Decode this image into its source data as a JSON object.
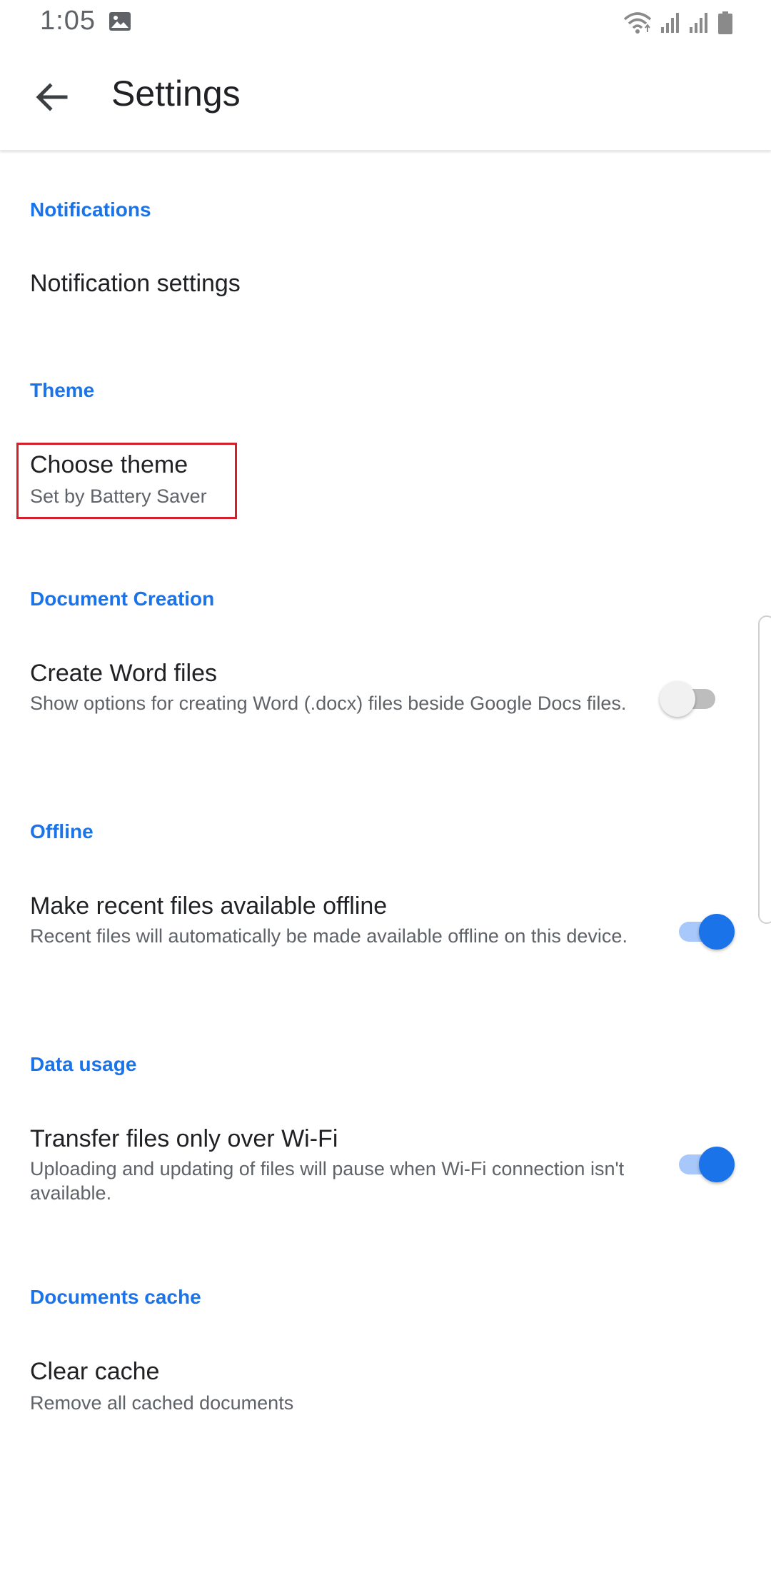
{
  "status_bar": {
    "time": "1:05",
    "left_icons": [
      "gallery-icon"
    ],
    "right_icons": [
      "wifi-icon",
      "signal-icon",
      "signal-icon",
      "battery-icon"
    ]
  },
  "app_bar": {
    "back_icon": "arrow-back-icon",
    "title": "Settings"
  },
  "sections": {
    "notifications": {
      "header": "Notifications",
      "item_title": "Notification settings"
    },
    "theme": {
      "header": "Theme",
      "item_title": "Choose theme",
      "item_subtitle": "Set by Battery Saver"
    },
    "document_creation": {
      "header": "Document Creation",
      "item_title": "Create Word files",
      "item_subtitle": "Show options for creating Word (.docx) files beside Google Docs files.",
      "toggle_on": false
    },
    "offline": {
      "header": "Offline",
      "item_title": "Make recent files available offline",
      "item_subtitle": "Recent files will automatically be made available offline on this device.",
      "toggle_on": true
    },
    "data_usage": {
      "header": "Data usage",
      "item_title": "Transfer files only over Wi-Fi",
      "item_subtitle": "Uploading and updating of files will pause when Wi-Fi connection isn't available.",
      "toggle_on": true
    },
    "documents_cache": {
      "header": "Documents cache",
      "item_title": "Clear cache",
      "item_subtitle": "Remove all cached documents"
    }
  },
  "colors": {
    "accent": "#1a73e8",
    "highlight": "#d3212c",
    "text_primary": "#202124",
    "text_secondary": "#5f6368"
  }
}
